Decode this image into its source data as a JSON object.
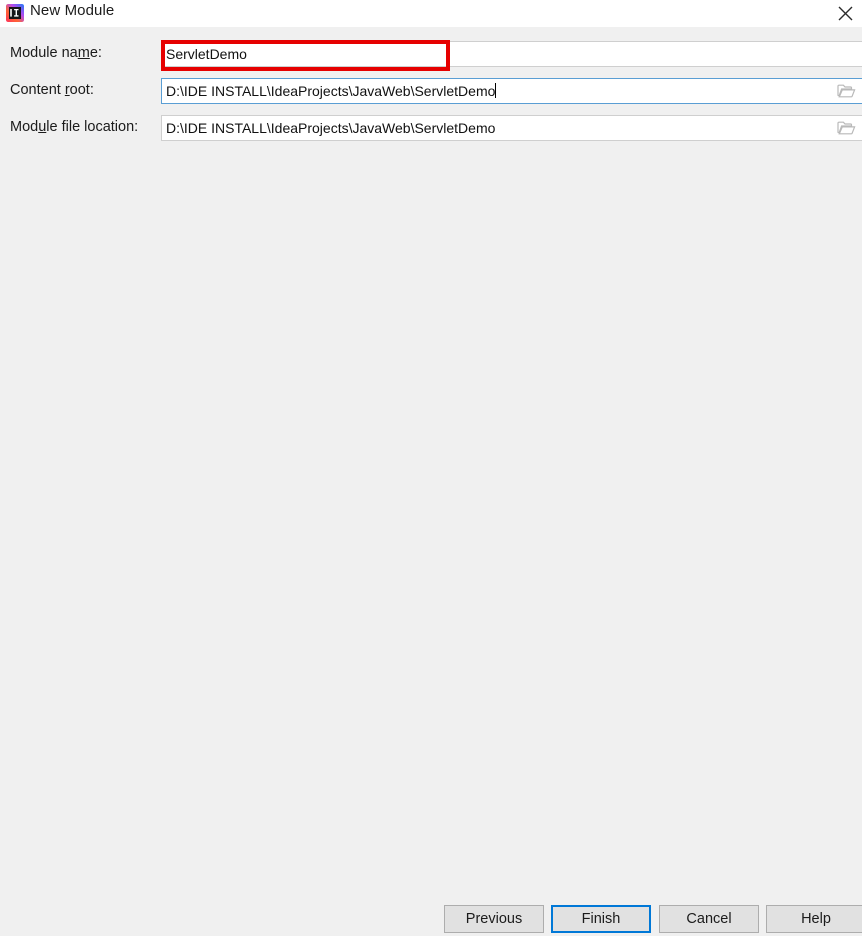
{
  "window": {
    "title": "New Module",
    "icon": "intellij-idea-icon",
    "close_label": "close-icon"
  },
  "form": {
    "fields": [
      {
        "label_pre": "Module na",
        "label_mnemonic": "m",
        "label_post": "e:",
        "label_full": "Module name:",
        "value": "ServletDemo",
        "has_browse": false,
        "has_caret": false,
        "highlighted": true
      },
      {
        "label_pre": "Content ",
        "label_mnemonic": "r",
        "label_post": "oot:",
        "label_full": "Content root:",
        "value": "D:\\IDE INSTALL\\IdeaProjects\\JavaWeb\\ServletDemo",
        "has_browse": true,
        "has_caret": true,
        "highlighted": false
      },
      {
        "label_pre": "Mod",
        "label_mnemonic": "u",
        "label_post": "le file location:",
        "label_full": "Module file location:",
        "value": "D:\\IDE INSTALL\\IdeaProjects\\JavaWeb\\ServletDemo",
        "has_browse": true,
        "has_caret": false,
        "highlighted": false
      }
    ]
  },
  "buttons": {
    "previous": "Previous",
    "finish": "Finish",
    "cancel": "Cancel",
    "help": "Help"
  },
  "colors": {
    "annotation": "#e60000",
    "focus_border": "#5a9ed4",
    "default_button_border": "#0078d7",
    "panel_bg": "#f0f0f0",
    "titlebar_bg": "#ffffff"
  }
}
